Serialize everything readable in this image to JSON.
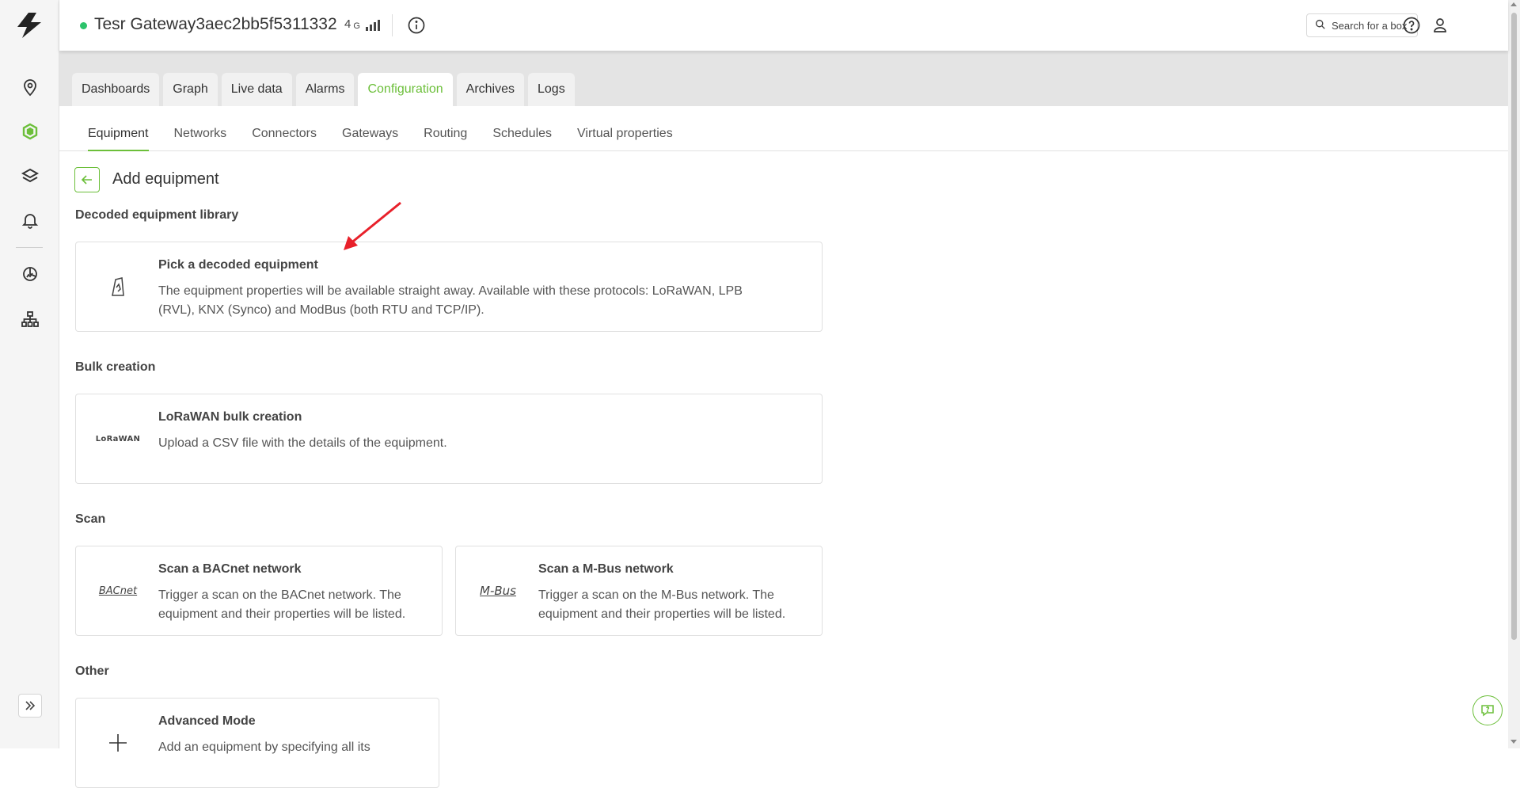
{
  "gateway": {
    "title": "Tesr Gateway3aec2bb5f5311332",
    "status_color": "#2cc36b",
    "network": "4",
    "network_suffix": "G"
  },
  "search": {
    "placeholder": "Search for a box"
  },
  "tabs": [
    {
      "label": "Dashboards"
    },
    {
      "label": "Graph"
    },
    {
      "label": "Live data"
    },
    {
      "label": "Alarms"
    },
    {
      "label": "Configuration",
      "active": true
    },
    {
      "label": "Archives"
    },
    {
      "label": "Logs"
    }
  ],
  "subtabs": [
    {
      "label": "Equipment",
      "active": true
    },
    {
      "label": "Networks"
    },
    {
      "label": "Connectors"
    },
    {
      "label": "Gateways"
    },
    {
      "label": "Routing"
    },
    {
      "label": "Schedules"
    },
    {
      "label": "Virtual properties"
    }
  ],
  "page": {
    "title": "Add equipment"
  },
  "sections": {
    "decoded": {
      "title": "Decoded equipment library",
      "card": {
        "title": "Pick a decoded equipment",
        "desc_line1": "The equipment properties will be available straight away. Available with these protocols: LoRaWAN, LPB",
        "desc_line2": "(RVL), KNX (Synco) and ModBus (both RTU and TCP/IP).",
        "icon": "sensor-icon"
      }
    },
    "bulk": {
      "title": "Bulk creation",
      "card": {
        "title": "LoRaWAN bulk creation",
        "desc_line1": "Upload a CSV file with the details of the equipment.",
        "logo": "LoRaWAN"
      }
    },
    "scan": {
      "title": "Scan",
      "bacnet": {
        "title": "Scan a BACnet network",
        "desc_line1": "Trigger a scan on the BACnet network. The",
        "desc_line2": "equipment and their properties will be listed.",
        "logo": "BACnet"
      },
      "mbus": {
        "title": "Scan a M-Bus network",
        "desc_line1": "Trigger a scan on the M-Bus network. The",
        "desc_line2": "equipment and their properties will be listed.",
        "logo": "M-Bus"
      }
    },
    "other": {
      "title": "Other",
      "card": {
        "title": "Advanced Mode",
        "desc_line1": "Add an equipment by specifying all its",
        "icon": "plus-icon"
      }
    }
  },
  "colors": {
    "accent": "#6cbf3a",
    "annotation_arrow": "#e8202a"
  }
}
